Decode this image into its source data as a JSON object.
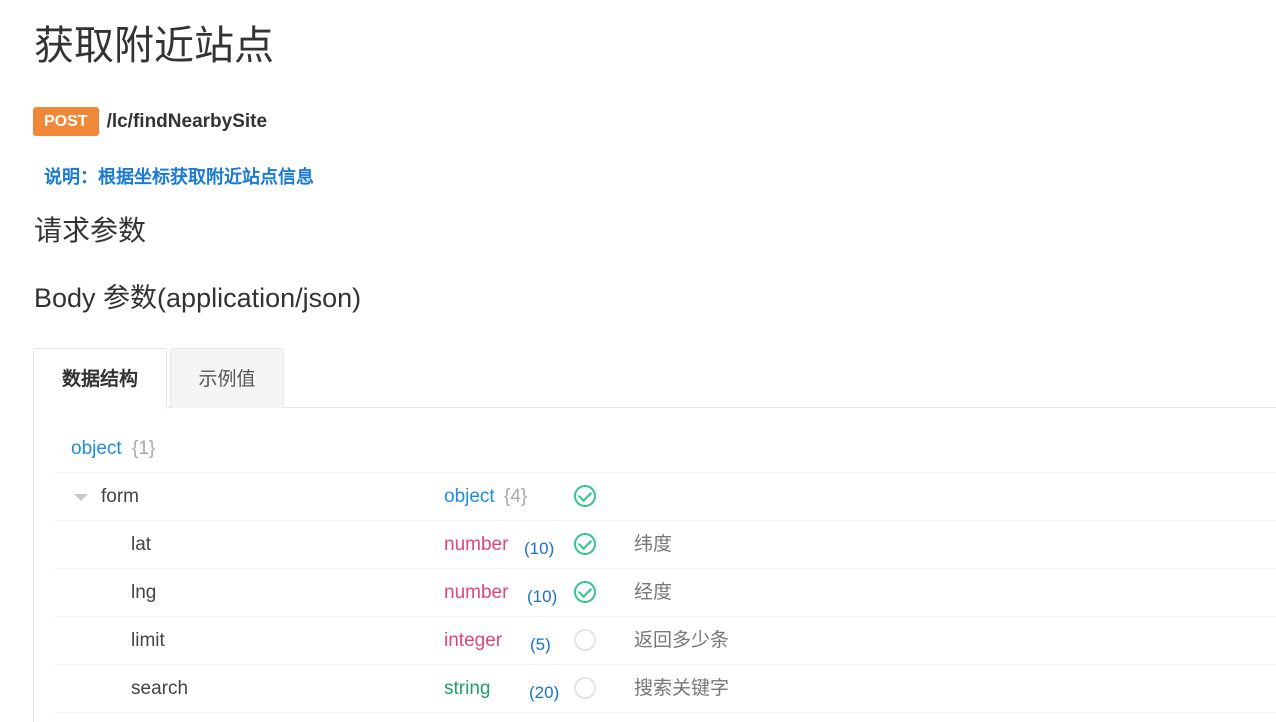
{
  "page": {
    "title": "获取附近站点",
    "method": "POST",
    "path": "/lc/findNearbySite",
    "description": "说明：根据坐标获取附近站点信息",
    "section_title": "请求参数",
    "body_title": "Body 参数(application/json)"
  },
  "tabs": [
    {
      "label": "数据结构",
      "active": true
    },
    {
      "label": "示例值",
      "active": false
    }
  ],
  "schema": {
    "root": {
      "type": "object",
      "count": "{1}"
    },
    "rows": [
      {
        "name": "form",
        "type": "object",
        "count": "{4}",
        "len": "",
        "required": true,
        "note": ""
      },
      {
        "name": "lat",
        "type": "number",
        "count": "",
        "len": "(10)",
        "required": true,
        "note": "纬度"
      },
      {
        "name": "lng",
        "type": "number",
        "count": "",
        "len": "(10)",
        "required": true,
        "note": "经度"
      },
      {
        "name": "limit",
        "type": "integer",
        "count": "",
        "len": "(5)",
        "required": false,
        "note": "返回多少条"
      },
      {
        "name": "search",
        "type": "string",
        "count": "",
        "len": "(20)",
        "required": false,
        "note": "搜索关键字"
      }
    ]
  },
  "colors": {
    "method_badge": "#f0883a",
    "description": "#1a7bd6",
    "type_object": "#1e8ce0",
    "type_number": "#e0457b",
    "type_string": "#22a06b",
    "required_check": "#34c38f"
  }
}
